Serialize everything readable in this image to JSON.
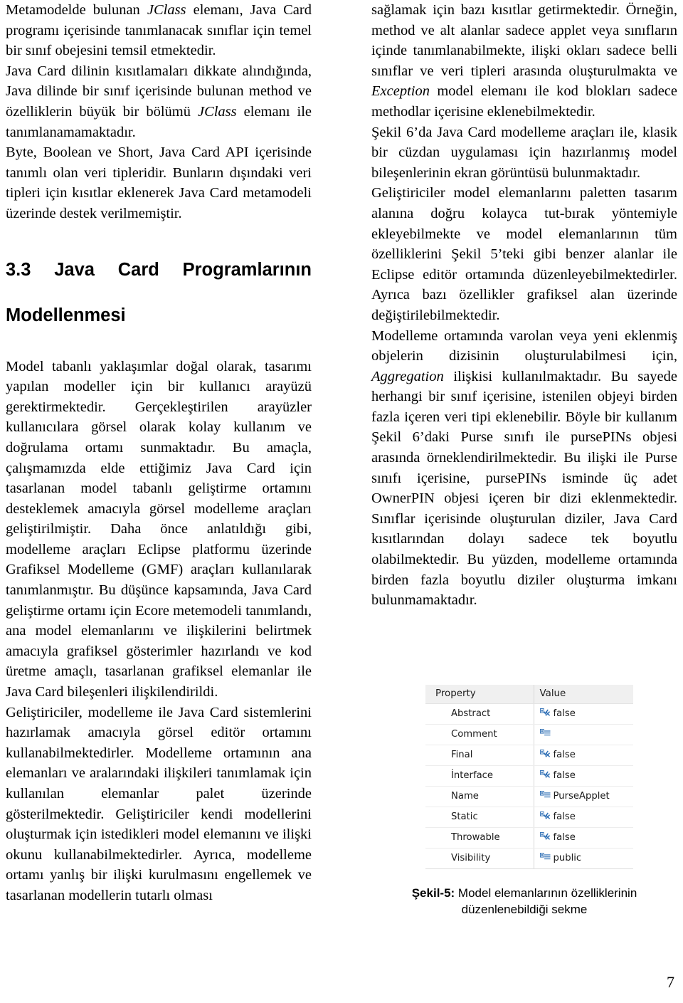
{
  "document": {
    "page_number": "7"
  },
  "left_column": {
    "paragraphs": [
      {
        "id": "p1",
        "runs": [
          {
            "text": "Metamodelde bulunan ",
            "style": "normal"
          },
          {
            "text": "JClass",
            "style": "italic"
          },
          {
            "text": " elemanı, Java Card programı içerisinde tanımlanacak sınıflar için temel bir sınıf obejesini temsil etmektedir.",
            "style": "normal"
          }
        ]
      },
      {
        "id": "p2",
        "runs": [
          {
            "text": "Java Card dilinin kısıtlamaları dikkate alındığında, Java dilinde bir sınıf içerisinde bulunan method ve özelliklerin büyük bir bölümü ",
            "style": "normal"
          },
          {
            "text": "JClass",
            "style": "italic"
          },
          {
            "text": " elemanı ile tanımlanamamaktadır.",
            "style": "normal"
          }
        ]
      },
      {
        "id": "p3",
        "runs": [
          {
            "text": "Byte, Boolean ve Short, Java Card API içerisinde tanımlı olan veri tipleridir. Bunların dışındaki veri tipleri için kısıtlar eklenerek Java Card metamodeli üzerinde destek verilmemiştir.",
            "style": "normal"
          }
        ]
      },
      {
        "id": "p4",
        "runs": [
          {
            "text": "Model tabanlı yaklaşımlar doğal olarak, tasarımı yapılan modeller için bir kullanıcı arayüzü gerektirmektedir. Gerçekleştirilen arayüzler kullanıcılara görsel olarak kolay kullanım ve doğrulama ortamı sunmaktadır. Bu amaçla, çalışmamızda elde ettiğimiz Java Card için tasarlanan model tabanlı geliştirme ortamını desteklemek amacıyla görsel modelleme araçları geliştirilmiştir. Daha önce anlatıldığı gibi, modelleme araçları Eclipse platformu üzerinde Grafiksel Modelleme (GMF) araçları kullanılarak tanımlanmıştır. Bu düşünce kapsamında, Java Card geliştirme ortamı için Ecore metemodeli tanımlandı, ana model elemanlarını ve ilişkilerini belirtmek amacıyla grafiksel gösterimler hazırlandı ve kod üretme amaçlı, tasarlanan grafiksel elemanlar ile Java Card bileşenleri ilişkilendirildi.",
            "style": "normal"
          }
        ]
      },
      {
        "id": "p5",
        "runs": [
          {
            "text": "Geliştiriciler, modelleme ile Java Card sistemlerini hazırlamak amacıyla görsel editör ortamını kullanabilmektedirler. Modelleme ortamının ana elemanları ve aralarındaki ilişkileri tanımlamak için kullanılan elemanlar palet üzerinde gösterilmektedir. Geliştiriciler kendi modellerini oluşturmak için istedikleri model elemanını ve ilişki okunu kullanabilmektedirler. Ayrıca, modelleme ortamı yanlış bir ilişki kurulmasını engellemek ve tasarlanan modellerin tutarlı olması",
            "style": "normal"
          }
        ]
      }
    ],
    "heading": {
      "line1": "3.3 Java Card Programlarının",
      "line2": "Modellenmesi"
    }
  },
  "right_column": {
    "paragraphs": [
      {
        "id": "r1",
        "runs": [
          {
            "text": "sağlamak için bazı kısıtlar getirmektedir. Örneğin, method ve alt alanlar sadece applet veya sınıfların içinde tanımlanabilmekte, ilişki okları sadece belli sınıflar ve veri tipleri arasında oluşturulmakta ve ",
            "style": "normal"
          },
          {
            "text": "Exception",
            "style": "italic"
          },
          {
            "text": " model elemanı ile kod blokları sadece methodlar içerisine eklenebilmektedir.",
            "style": "normal"
          }
        ]
      },
      {
        "id": "r2",
        "runs": [
          {
            "text": "Şekil 6’da Java Card modelleme araçları ile, klasik bir cüzdan uygulaması için hazırlanmış model bileşenlerinin ekran görüntüsü bulunmaktadır.",
            "style": "normal"
          }
        ]
      },
      {
        "id": "r3",
        "runs": [
          {
            "text": "Geliştiriciler model elemanlarını paletten tasarım alanına doğru kolayca tut-bırak yöntemiyle ekleyebilmekte ve model elemanlarının tüm özelliklerini Şekil 5’teki gibi benzer alanlar ile Eclipse editör ortamında düzenleyebilmektedirler. Ayrıca bazı özellikler grafiksel alan üzerinde değiştirilebilmektedir.",
            "style": "normal"
          }
        ]
      },
      {
        "id": "r4",
        "runs": [
          {
            "text": "Modelleme ortamında varolan veya yeni eklenmiş objelerin dizisinin oluşturulabilmesi için, ",
            "style": "normal"
          },
          {
            "text": "Aggregation",
            "style": "italic"
          },
          {
            "text": " ilişkisi kullanılmaktadır. Bu sayede herhangi bir sınıf içerisine, istenilen objeyi birden fazla içeren veri tipi eklenebilir. Böyle bir kullanım Şekil 6’daki Purse sınıfı ile pursePINs objesi arasında örneklendirilmektedir. Bu ilişki ile Purse sınıfı içerisine, pursePINs isminde üç adet OwnerPIN objesi içeren bir dizi eklenmektedir. Sınıflar içerisinde oluşturulan diziler, Java Card kısıtlarından dolayı sadece tek boyutlu olabilmektedir. Bu yüzden, modelleme ortamında birden fazla boyutlu diziler oluşturma imkanı bulunmamaktadır.",
            "style": "normal"
          }
        ]
      }
    ]
  },
  "figure": {
    "caption_label": "Şekil-5:",
    "caption_text": " Model elemanlarının özelliklerinin düzenlenebildiği sekme",
    "table": {
      "headers": [
        "Property",
        "Value"
      ],
      "rows": [
        {
          "property": "Abstract",
          "icon": "boolean-property-icon",
          "value": "false"
        },
        {
          "property": "Comment",
          "icon": "text-property-icon",
          "value": ""
        },
        {
          "property": "Final",
          "icon": "boolean-property-icon",
          "value": "false"
        },
        {
          "property": "İnterface",
          "icon": "boolean-property-icon",
          "value": "false"
        },
        {
          "property": "Name",
          "icon": "text-property-icon",
          "value": "PurseApplet"
        },
        {
          "property": "Static",
          "icon": "boolean-property-icon",
          "value": "false"
        },
        {
          "property": "Throwable",
          "icon": "boolean-property-icon",
          "value": "false"
        },
        {
          "property": "Visibility",
          "icon": "text-property-icon",
          "value": "public"
        }
      ]
    },
    "colors": {
      "header_background": "#f0f0f0",
      "row_divider": "#ededed",
      "icon_blue": "#2f6fb5",
      "text": "#1b1b1b"
    }
  }
}
